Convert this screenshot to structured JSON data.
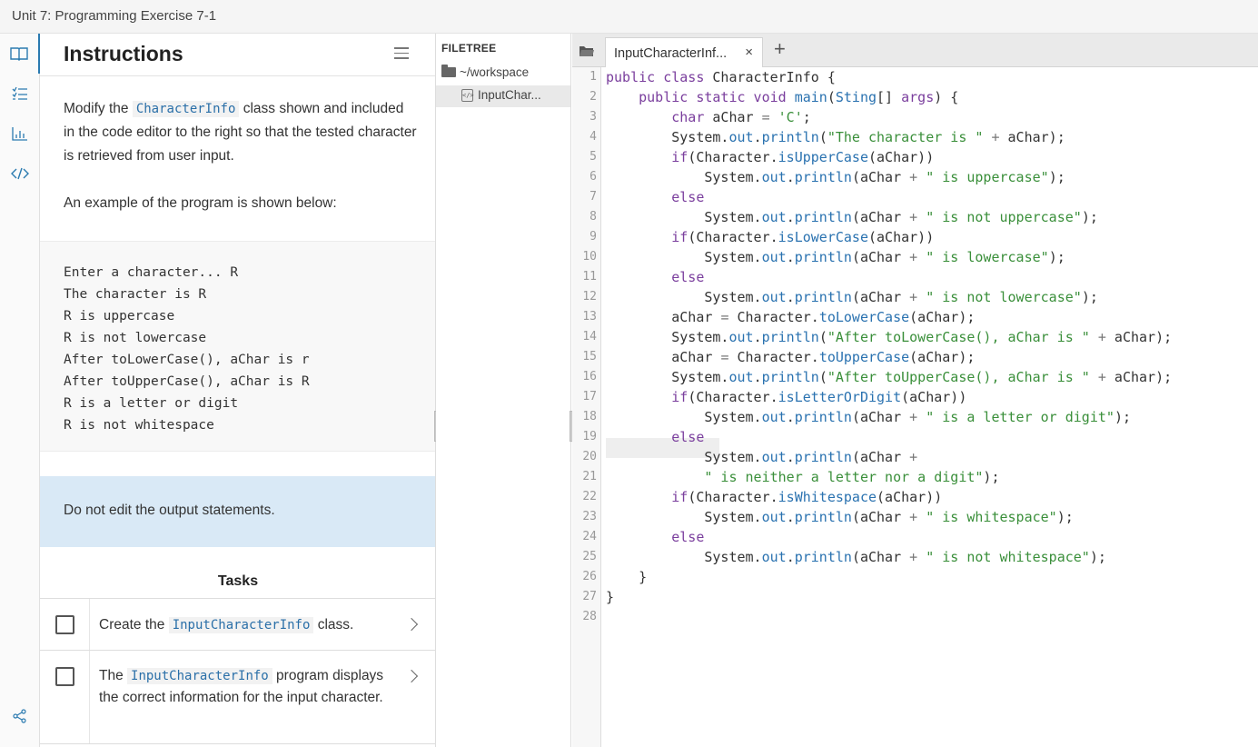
{
  "window": {
    "title": "Unit 7: Programming Exercise 7-1"
  },
  "rail": {
    "icons": [
      "book-icon",
      "list-icon",
      "chart-icon",
      "code-icon",
      "share-icon"
    ]
  },
  "instructions": {
    "title": "Instructions",
    "para1": {
      "before": "Modify the ",
      "code": "CharacterInfo",
      "after": " class shown and included in the code editor to the right so that the tested character is retrieved from user input."
    },
    "para2": "An example of the program is shown below:",
    "example_lines": [
      "Enter a character... R",
      "The character is R",
      "R is uppercase",
      "R is not lowercase",
      "After toLowerCase(), aChar is r",
      "After toUpperCase(), aChar is R",
      "R is a letter or digit",
      "R is not whitespace"
    ],
    "note": "Do not edit the output statements.",
    "tasks_title": "Tasks",
    "tasks": [
      {
        "before": "Create the ",
        "code": "InputCharacterInfo",
        "after": " class."
      },
      {
        "before": "The ",
        "code": "InputCharacterInfo",
        "after": " program displays the correct information for the input character."
      }
    ]
  },
  "filetree": {
    "heading": "FILETREE",
    "folder": "~/workspace",
    "file": "InputChar..."
  },
  "editor": {
    "tab_label": "InputCharacterInf...",
    "tab_close": "×",
    "add_tab": "+",
    "line_count": 28,
    "highlighted_line": 19
  }
}
